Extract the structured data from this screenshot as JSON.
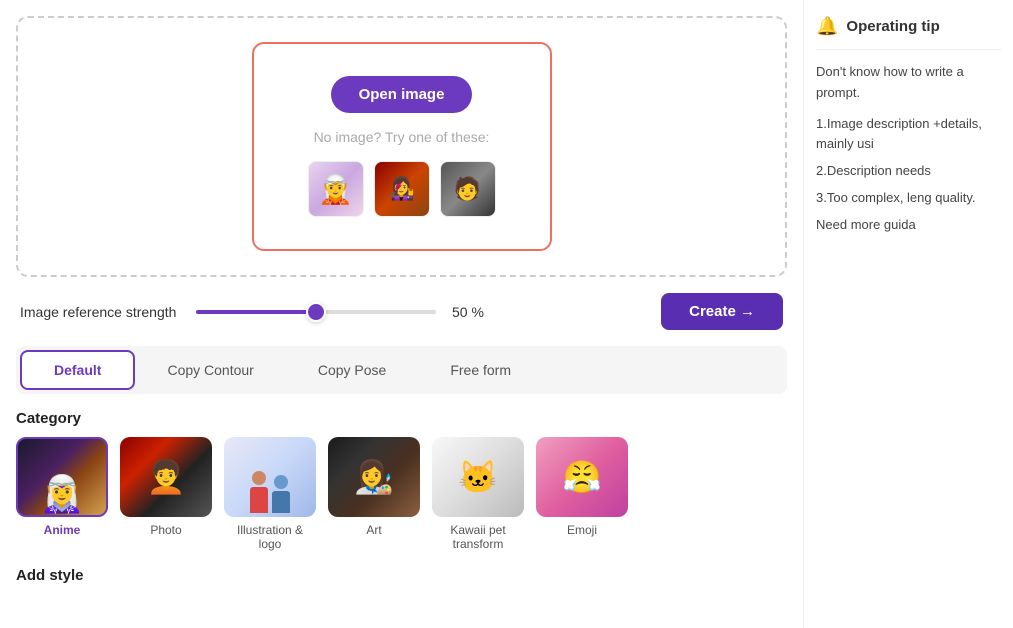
{
  "main": {
    "upload": {
      "open_image_label": "Open image",
      "no_image_text": "No image? Try one of these:",
      "sample_images": [
        {
          "id": "sample-1",
          "alt": "Anime girl sample"
        },
        {
          "id": "sample-2",
          "alt": "Illustrated girl sample"
        },
        {
          "id": "sample-3",
          "alt": "Real person sample"
        }
      ]
    },
    "strength": {
      "label": "Image reference strength",
      "value": 50,
      "unit": "%",
      "min": 0,
      "max": 100
    },
    "create_button": "Create →",
    "tabs": [
      {
        "id": "default",
        "label": "Default",
        "active": true
      },
      {
        "id": "copy-contour",
        "label": "Copy Contour",
        "active": false
      },
      {
        "id": "copy-pose",
        "label": "Copy Pose",
        "active": false
      },
      {
        "id": "free-form",
        "label": "Free form",
        "active": false
      }
    ],
    "category_label": "Category",
    "categories": [
      {
        "id": "anime",
        "label": "Anime",
        "active": true
      },
      {
        "id": "photo",
        "label": "Photo",
        "active": false
      },
      {
        "id": "illustration",
        "label": "Illustration & logo",
        "active": false
      },
      {
        "id": "art",
        "label": "Art",
        "active": false
      },
      {
        "id": "kawaii",
        "label": "Kawaii pet transform",
        "active": false
      },
      {
        "id": "emoji",
        "label": "Emoji",
        "active": false
      }
    ],
    "add_style_label": "Add style"
  },
  "sidebar": {
    "tips_title": "Operating tip",
    "tip_intro": "Don't know how to write a prompt.",
    "tip_1": "1.Image description +details, mainly usi",
    "tip_2": "2.Description needs",
    "tip_3": "3.Too complex, leng quality.",
    "tip_more": "Need more guida"
  }
}
